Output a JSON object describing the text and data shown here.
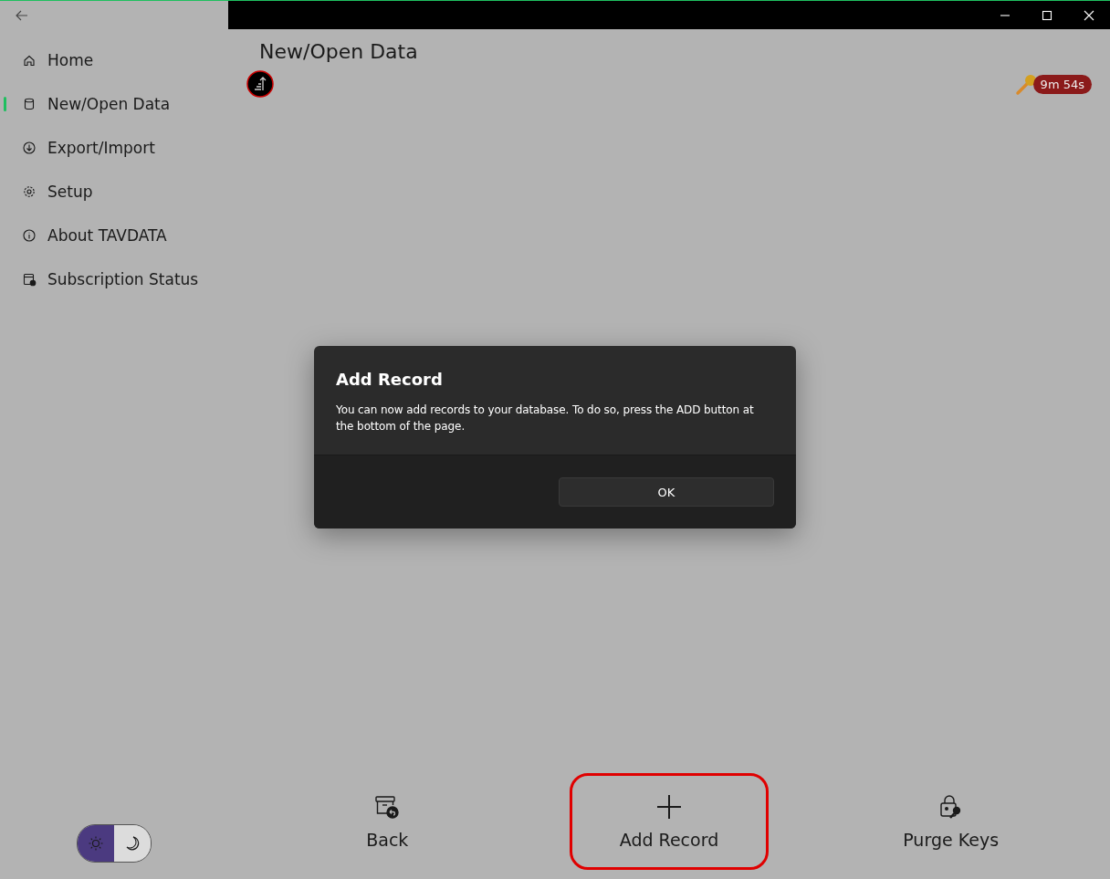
{
  "window": {
    "controls": [
      {
        "kind": "minimize"
      },
      {
        "kind": "maximize"
      },
      {
        "kind": "close"
      }
    ]
  },
  "sidebar": {
    "items": [
      {
        "label": "Home",
        "selected": false
      },
      {
        "label": "New/Open Data",
        "selected": true
      },
      {
        "label": "Export/Import",
        "selected": false
      },
      {
        "label": "Setup",
        "selected": false
      },
      {
        "label": "About TAVDATA",
        "selected": false
      },
      {
        "label": "Subscription Status",
        "selected": false
      }
    ],
    "theme_toggle": [
      {
        "kind": "light",
        "selected": true
      },
      {
        "kind": "dark",
        "selected": false
      }
    ]
  },
  "page": {
    "title": "New/Open Data",
    "timer": "9m 54s"
  },
  "dialog": {
    "title": "Add Record",
    "message": "You can now add records to your database. To do so, press the ADD button at the bottom of the page.",
    "button": "OK"
  },
  "bottom_buttons": [
    {
      "label": "Back",
      "highlighted": false
    },
    {
      "label": "Add Record",
      "highlighted": true
    },
    {
      "label": "Purge Keys",
      "highlighted": false
    }
  ]
}
